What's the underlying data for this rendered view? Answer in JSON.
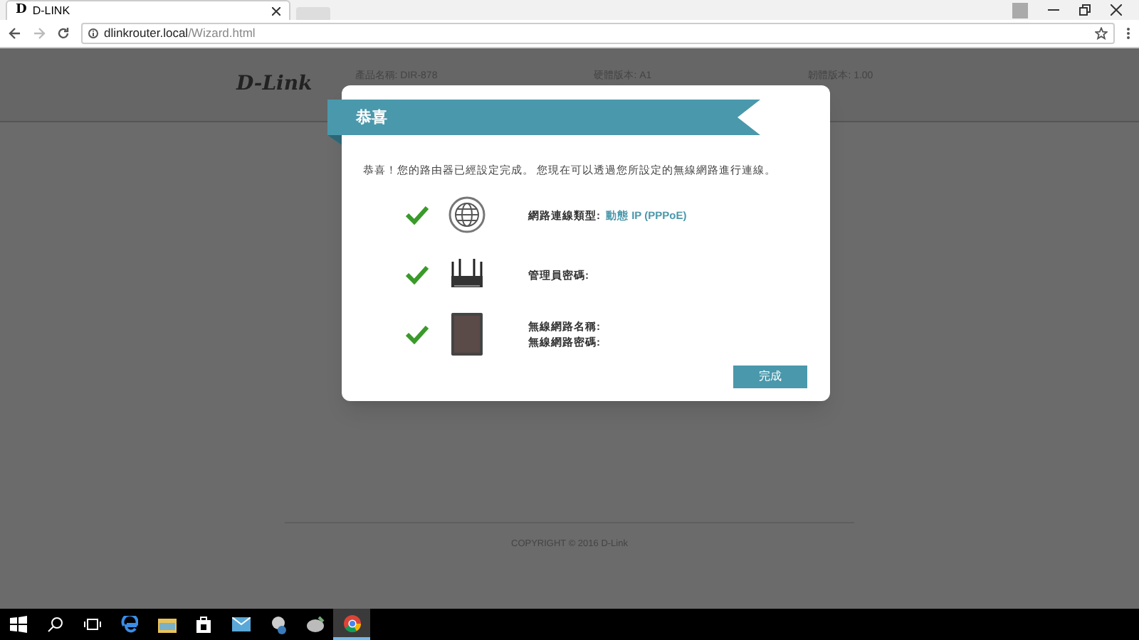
{
  "browser": {
    "favicon": "D",
    "tab_title": "D-LINK",
    "url_host": "dlinkrouter.local",
    "url_path": "/Wizard.html"
  },
  "header": {
    "logo": "D-Link",
    "info": [
      "產品名稱: DIR-878",
      "硬體版本: A1",
      "韌體版本: 1.00"
    ]
  },
  "dialog": {
    "title": "恭喜",
    "message": "恭喜！您的路由器已經設定完成。 您現在可以透過您所設定的無線網路進行連線。",
    "items": [
      {
        "kind": "globe",
        "checked": true,
        "lines": [
          {
            "label": "網路連線類型:",
            "value": "動態 IP (PPPoE)"
          }
        ]
      },
      {
        "kind": "router",
        "checked": true,
        "lines": [
          {
            "label": "管理員密碼:"
          }
        ]
      },
      {
        "kind": "tablet",
        "checked": true,
        "lines": [
          {
            "label": "無線網路名稱:"
          },
          {
            "label": "無線網路密碼:"
          }
        ]
      }
    ],
    "button": "完成"
  },
  "footer": {
    "copyright": "COPYRIGHT © 2016 D-Link"
  },
  "taskbar": {
    "apps": [
      {
        "kind": "start",
        "selected": false
      },
      {
        "kind": "search",
        "selected": false
      },
      {
        "kind": "taskview",
        "selected": false
      },
      {
        "kind": "edge",
        "selected": false
      },
      {
        "kind": "folder",
        "selected": false
      },
      {
        "kind": "store",
        "selected": false
      },
      {
        "kind": "mail",
        "selected": false
      },
      {
        "kind": "app",
        "selected": false
      },
      {
        "kind": "app2",
        "selected": false
      },
      {
        "kind": "chrome",
        "selected": true
      }
    ]
  }
}
